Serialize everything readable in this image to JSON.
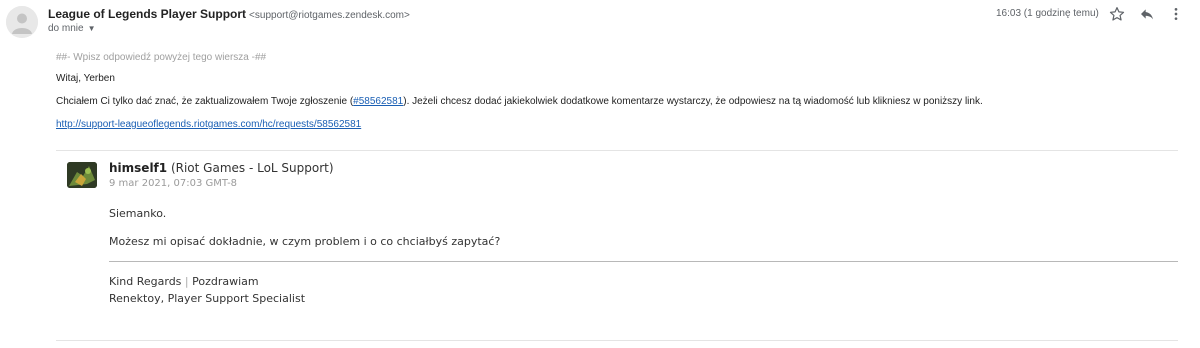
{
  "header": {
    "sender_name": "League of Legends Player Support",
    "sender_email": "<support@riotgames.zendesk.com>",
    "recipient": "do mnie",
    "timestamp": "16:03 (1 godzinę temu)"
  },
  "icons": {
    "avatar": "person-icon",
    "star": "star-icon",
    "reply": "reply-icon",
    "more": "more-vert-icon"
  },
  "email": {
    "reply_hint": "##- Wpisz odpowiedź powyżej tego wiersza -##",
    "greeting": "Witaj, Yerben",
    "message_before": "Chciałem Ci tylko dać znać, że zaktualizowałem Twoje zgłoszenie (",
    "ticket_link": "#58562581",
    "message_after": "). Jeżeli chcesz dodać jakiekolwiek dodatkowe komentarze wystarczy, że odpowiesz na tą wiadomość lub klikniesz w poniższy link.",
    "ticket_url": "http://support-leagueoflegends.riotgames.com/hc/requests/58562581"
  },
  "quoted": {
    "author": "himself1",
    "role": "(Riot Games - LoL Support)",
    "date": "9 mar 2021, 07:03 GMT-8",
    "greeting": "Siemanko.",
    "question": "Możesz mi opisać dokładnie, w czym problem i o co chciałbyś zapytać?",
    "signature_kind": "Kind Regards",
    "signature_pipe": "|",
    "signature_pl": "Pozdrawiam",
    "signature_name": "Renektoy, Player Support Specialist"
  }
}
